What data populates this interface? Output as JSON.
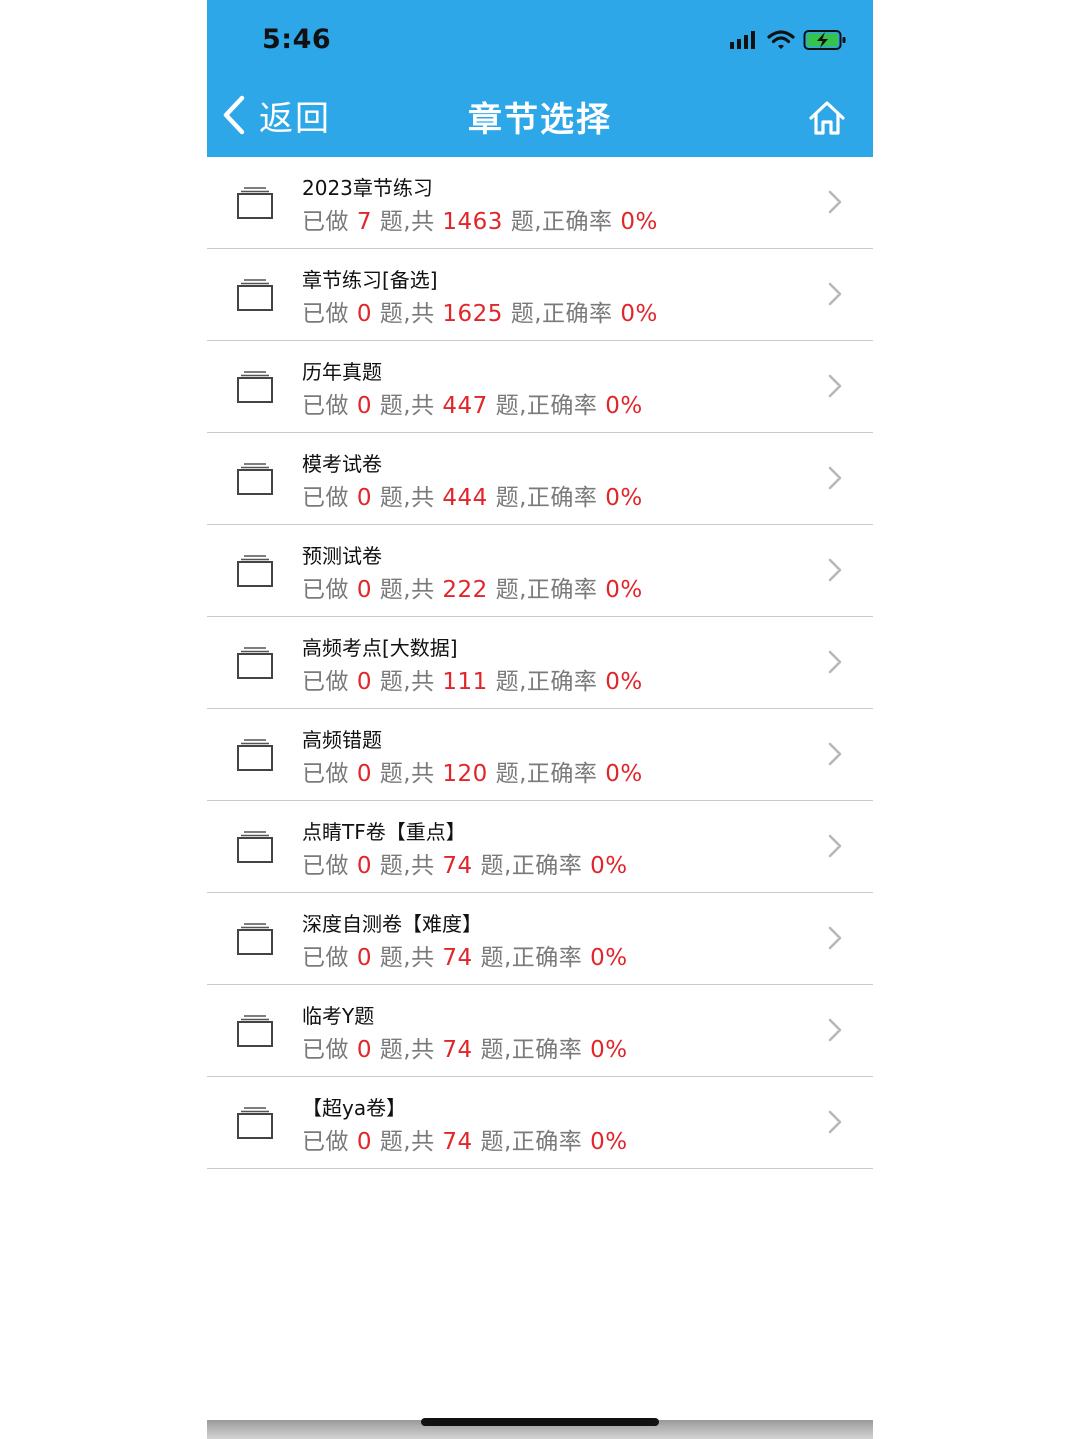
{
  "status_bar": {
    "time": "5:46",
    "icons": [
      "signal-icon",
      "wifi-icon",
      "battery-charging-icon"
    ]
  },
  "nav": {
    "back_label": "返回",
    "title": "章节选择",
    "home_icon": "home-icon"
  },
  "colors": {
    "header_bg": "#2ea7e8",
    "number_red": "#e0262a",
    "stats_gray": "#7a7a7a"
  },
  "stats_template": {
    "done_prefix": "已做",
    "total_prefix": "题,共",
    "accuracy_prefix": "题,正确率"
  },
  "chapters": [
    {
      "name": "2023章节练习",
      "done": "7",
      "total": "1463",
      "accuracy": "0%"
    },
    {
      "name": "章节练习[备选]",
      "done": "0",
      "total": "1625",
      "accuracy": "0%"
    },
    {
      "name": "历年真题",
      "done": "0",
      "total": "447",
      "accuracy": "0%"
    },
    {
      "name": "模考试卷",
      "done": "0",
      "total": "444",
      "accuracy": "0%"
    },
    {
      "name": "预测试卷",
      "done": "0",
      "total": "222",
      "accuracy": "0%"
    },
    {
      "name": "高频考点[大数据]",
      "done": "0",
      "total": "111",
      "accuracy": "0%"
    },
    {
      "name": "高频错题",
      "done": "0",
      "total": "120",
      "accuracy": "0%"
    },
    {
      "name": "点睛TF卷【重点】",
      "done": "0",
      "total": "74",
      "accuracy": "0%"
    },
    {
      "name": "深度自测卷【难度】",
      "done": "0",
      "total": "74",
      "accuracy": "0%"
    },
    {
      "name": "临考Y题",
      "done": "0",
      "total": "74",
      "accuracy": "0%"
    },
    {
      "name": "【超ya卷】",
      "done": "0",
      "total": "74",
      "accuracy": "0%"
    }
  ]
}
